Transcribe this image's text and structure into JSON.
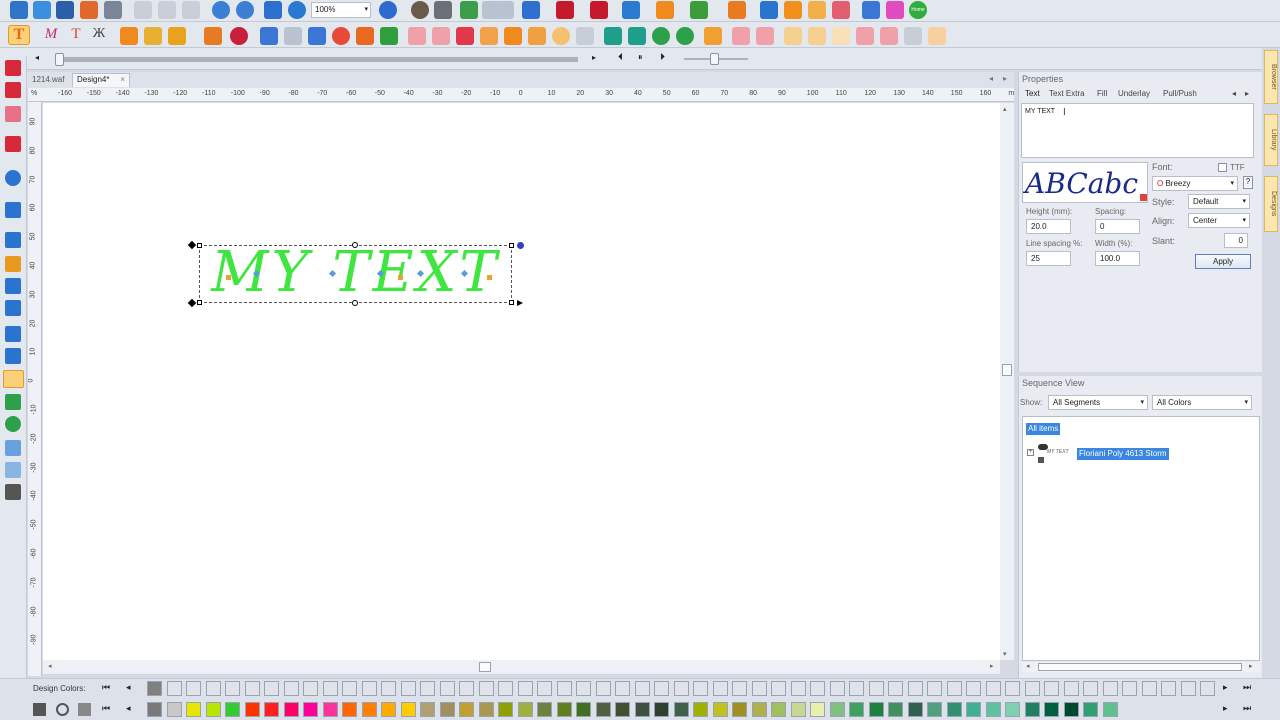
{
  "toolbar": {
    "zoom_value": "100%",
    "home_button": "Home"
  },
  "tabs": {
    "file1": "1214.waf",
    "file2": "Design4*",
    "close": "×"
  },
  "ruler": {
    "unit": "%",
    "h_ticks": [
      "-160",
      "-150",
      "-140",
      "-130",
      "-120",
      "-110",
      "-100",
      "-90",
      "-80",
      "-70",
      "-60",
      "-50",
      "-40",
      "-30",
      "-20",
      "-10",
      "0",
      "10",
      "20",
      "30",
      "40",
      "50",
      "60",
      "70",
      "80",
      "90",
      "100",
      "110",
      "120",
      "130",
      "140",
      "150",
      "160",
      "mm"
    ],
    "v_ticks": [
      "90",
      "80",
      "70",
      "60",
      "50",
      "40",
      "30",
      "20",
      "10",
      "0",
      "-10",
      "-20",
      "-30",
      "-40",
      "-50",
      "-60",
      "-70",
      "-80",
      "-90"
    ]
  },
  "canvas": {
    "text": "MY TEXT",
    "text_color": "#3fe63f"
  },
  "properties": {
    "title": "Properties",
    "tabs": [
      "Text",
      "Text Extra",
      "Fill",
      "Underlay",
      "Pull/Push"
    ],
    "text_value": "MY TEXT",
    "preview": "ABCabc",
    "font_label": "Font:",
    "ttf_label": "TTF",
    "font_value": "Breezy",
    "font_help": "?",
    "style_label": "Style:",
    "style_value": "Default",
    "align_label": "Align:",
    "align_value": "Center",
    "slant_label": "Slant:",
    "slant_value": "0",
    "height_label": "Height (mm):",
    "height_value": "20.0",
    "spacing_label": "Spacing:",
    "spacing_value": "0",
    "line_spacing_label": "Line spacing %:",
    "line_spacing_value": "25",
    "width_label": "Width (%):",
    "width_value": "100.0",
    "apply_label": "Apply"
  },
  "side_tabs": [
    "Browser",
    "Library",
    "Designs"
  ],
  "sequence": {
    "title": "Sequence View",
    "show_label": "Show:",
    "segments_value": "All Segments",
    "colors_value": "All Colors",
    "all_items": "All items",
    "thread_name": "Floriani Poly 4613 Storm",
    "item_thumb": "MY TEXT"
  },
  "palette": {
    "design_colors_label": "Design Colors:",
    "design_colors": [
      "#808080",
      "#e0e4ea",
      "#e0e4ea",
      "#e0e4ea",
      "#e0e4ea",
      "#e0e4ea",
      "#e0e4ea",
      "#e0e4ea",
      "#e0e4ea",
      "#e0e4ea",
      "#e0e4ea",
      "#e0e4ea",
      "#e0e4ea",
      "#e0e4ea",
      "#e0e4ea",
      "#e0e4ea",
      "#e0e4ea",
      "#e0e4ea",
      "#e0e4ea",
      "#e0e4ea",
      "#e0e4ea",
      "#e0e4ea",
      "#e0e4ea",
      "#e0e4ea",
      "#e0e4ea",
      "#e0e4ea",
      "#e0e4ea",
      "#e0e4ea",
      "#e0e4ea",
      "#e0e4ea",
      "#e0e4ea",
      "#e0e4ea",
      "#e0e4ea",
      "#e0e4ea",
      "#e0e4ea",
      "#e0e4ea",
      "#e0e4ea",
      "#e0e4ea",
      "#e0e4ea",
      "#e0e4ea",
      "#e0e4ea",
      "#e0e4ea",
      "#e0e4ea",
      "#e0e4ea",
      "#e0e4ea",
      "#e0e4ea",
      "#e0e4ea",
      "#e0e4ea",
      "#e0e4ea",
      "#e0e4ea",
      "#e0e4ea",
      "#e0e4ea",
      "#e0e4ea",
      "#e0e4ea",
      "#e0e4ea"
    ],
    "thread_colors": [
      "#7a7a7a",
      "#c8c8c8",
      "#e6e600",
      "#b8e600",
      "#33cc33",
      "#ff3300",
      "#ff2020",
      "#ff0066",
      "#ff0099",
      "#ff3399",
      "#ff6600",
      "#ff8000",
      "#ffaa00",
      "#ffcc00",
      "#b0a070",
      "#a09060",
      "#c0a030",
      "#a89850",
      "#90a000",
      "#a0b040",
      "#708040",
      "#608020",
      "#407020",
      "#506040",
      "#405030",
      "#405040",
      "#304030",
      "#406048",
      "#a0b000",
      "#c0c020",
      "#a09020",
      "#b0b050",
      "#a0c060",
      "#c8d890",
      "#e8f0b0",
      "#80c080",
      "#40a060",
      "#208040",
      "#409060",
      "#306050",
      "#50a080",
      "#309070",
      "#40b090",
      "#60c0a0",
      "#80d0b0",
      "#208060",
      "#006040",
      "#004830",
      "#30a070",
      "#60c090"
    ]
  }
}
